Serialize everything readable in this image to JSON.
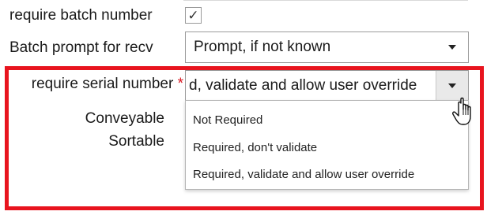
{
  "fields": {
    "require_batch": {
      "label": "require batch number",
      "checked": true,
      "check_glyph": "✓"
    },
    "batch_prompt": {
      "label": "Batch prompt for recv",
      "value": "Prompt, if not known"
    },
    "require_serial": {
      "label": "require serial number",
      "required_marker": "*",
      "value": "d, validate and allow user override",
      "open": true,
      "options": [
        "Not Required",
        "Required, don't validate",
        "Required, validate and allow user override"
      ]
    },
    "conveyable": {
      "label": "Conveyable"
    },
    "sortable": {
      "label": "Sortable"
    }
  },
  "highlight_color": "#e8141e",
  "icons": {
    "dropdown_arrow": "caret-down-icon",
    "cursor": "hand-pointer-icon",
    "checkmark": "check-icon"
  }
}
